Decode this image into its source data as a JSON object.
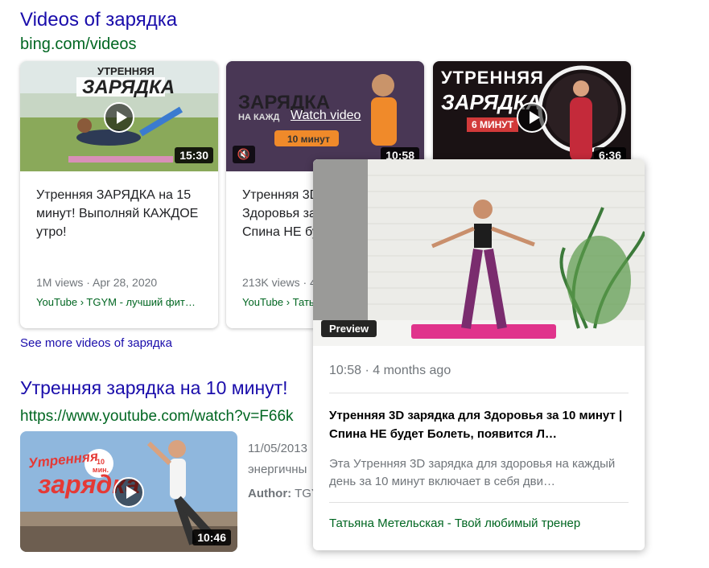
{
  "section": {
    "title": "Videos of зарядка",
    "url": "bing.com/videos"
  },
  "cards": [
    {
      "thumb_text1": "УТРЕННЯЯ",
      "thumb_text2": "ЗАРЯДКА",
      "duration": "15:30",
      "title": "Утренняя ЗАРЯДКА на 15 минут! Выполняй КАЖДОЕ утро!",
      "meta": "1M views · Apr 28, 2020",
      "source": "YouTube › TGYM - лучший фит…"
    },
    {
      "thumb_text1": "ЗАРЯДКА",
      "thumb_text2": "НА КАЖД",
      "thumb_text3": "10 минут",
      "watch_label": "Watch video",
      "duration": "10:58",
      "title": "Утренняя 3D зарядка для Здоровья за 10 минут | Спина НЕ будет Болеть",
      "meta": "213K views · 4 months ago",
      "source": "YouTube › Татьяна Метельская"
    },
    {
      "thumb_text1": "УТРЕННЯЯ",
      "thumb_text2": "ЗАРЯДКА",
      "thumb_text3": "6 МИНУТ",
      "duration": "6:36"
    }
  ],
  "see_more": "See more videos of зарядка",
  "result": {
    "title": "Утренняя зарядка на 10 минут!",
    "url": "https://www.youtube.com/watch?v=F66k",
    "thumb_text1": "Утренняя",
    "thumb_text2": "зарядка",
    "thumb_badge": "10 мин.",
    "duration": "10:46",
    "date": "11/05/2013",
    "snippet": "энергичны",
    "author_label": "Author:",
    "author": "TGY"
  },
  "popup": {
    "badge": "Preview",
    "meta": "10:58 · 4 months ago",
    "title": "Утренняя 3D зарядка для Здоровья за 10 минут | Спина НЕ будет Болеть, появится Л…",
    "description": "Эта Утренняя 3D зарядка для здоровья на каждый день за 10 минут включает в себя дви…",
    "channel": "Татьяна Метельская - Твой любимый тренер"
  },
  "colors": {
    "link": "#1a0dab",
    "url_green": "#006621",
    "meta_gray": "#70757a"
  }
}
